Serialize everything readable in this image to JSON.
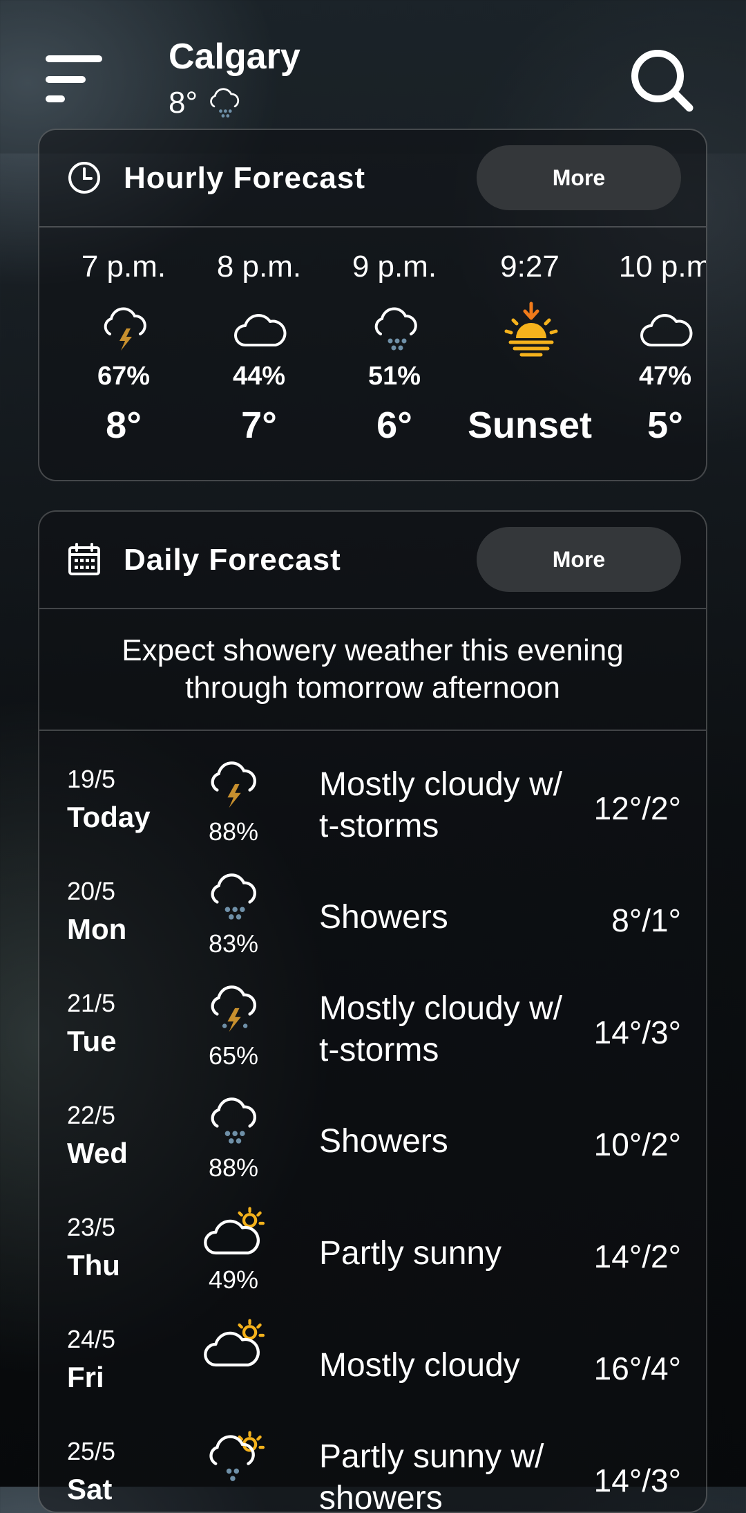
{
  "header": {
    "city": "Calgary",
    "current_temp": "8°",
    "current_icon": "rain-cloud-icon"
  },
  "hourly": {
    "title": "Hourly Forecast",
    "more_label": "More",
    "items": [
      {
        "time": "7 p.m.",
        "icon": "thunderstorm-icon",
        "precip": "67%",
        "temp": "8°"
      },
      {
        "time": "8 p.m.",
        "icon": "cloud-icon",
        "precip": "44%",
        "temp": "7°"
      },
      {
        "time": "9 p.m.",
        "icon": "rain-cloud-icon",
        "precip": "51%",
        "temp": "6°"
      },
      {
        "time": "9:27",
        "icon": "sunset-icon",
        "precip": "",
        "temp": "Sunset"
      },
      {
        "time": "10 p.m",
        "icon": "cloud-icon",
        "precip": "47%",
        "temp": "5°"
      }
    ]
  },
  "daily": {
    "title": "Daily Forecast",
    "more_label": "More",
    "summary": "Expect showery weather this evening through tomorrow afternoon",
    "items": [
      {
        "date": "19/5",
        "day": "Today",
        "icon": "thunderstorm-icon",
        "precip": "88%",
        "condition": "Mostly cloudy w/ t-storms",
        "temps": "12°/2°"
      },
      {
        "date": "20/5",
        "day": "Mon",
        "icon": "rain-cloud-icon",
        "precip": "83%",
        "condition": "Showers",
        "temps": "8°/1°"
      },
      {
        "date": "21/5",
        "day": "Tue",
        "icon": "thunderstorm-icon",
        "precip": "65%",
        "condition": "Mostly cloudy w/ t-storms",
        "temps": "14°/3°"
      },
      {
        "date": "22/5",
        "day": "Wed",
        "icon": "rain-cloud-icon",
        "precip": "88%",
        "condition": "Showers",
        "temps": "10°/2°"
      },
      {
        "date": "23/5",
        "day": "Thu",
        "icon": "partly-sunny-icon",
        "precip": "49%",
        "condition": "Partly sunny",
        "temps": "14°/2°"
      },
      {
        "date": "24/5",
        "day": "Fri",
        "icon": "partly-sunny-icon",
        "precip": "",
        "condition": "Mostly cloudy",
        "temps": "16°/4°"
      },
      {
        "date": "25/5",
        "day": "Sat",
        "icon": "partly-sunny-showers-icon",
        "precip": "",
        "condition": "Partly sunny w/ showers",
        "temps": "14°/3°"
      }
    ]
  },
  "colors": {
    "bolt": "#c8902e",
    "rain": "#6f90a8",
    "sun": "#f5b21c",
    "sunset_arrow": "#f07a1a"
  }
}
